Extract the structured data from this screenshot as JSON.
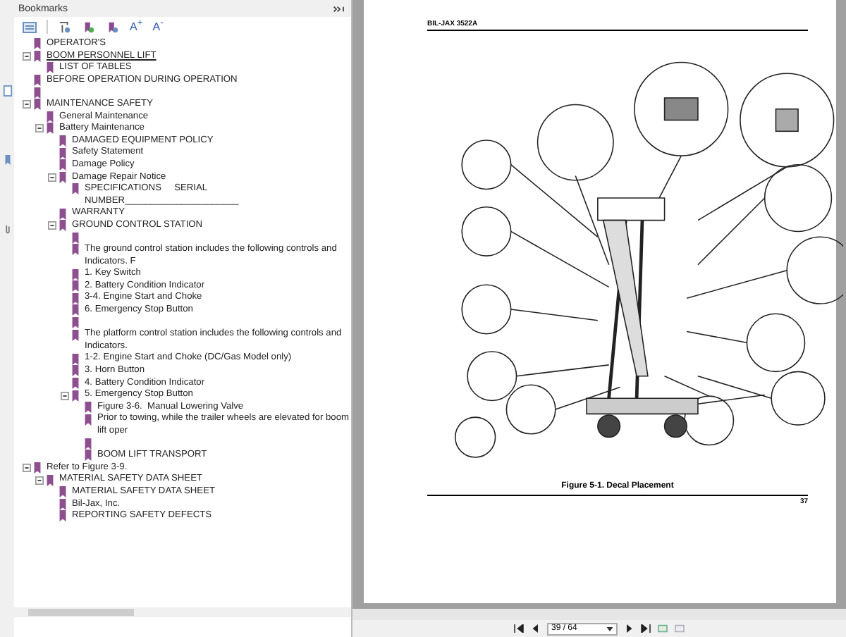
{
  "panel": {
    "title": "Bookmarks"
  },
  "font_buttons": [
    "A$^{+}$",
    "A$^{-}$"
  ],
  "bookmarks": [
    {
      "label": "OPERATOR'S"
    },
    {
      "label": "BOOM PERSONNEL LIFT",
      "expanded": true,
      "children": [
        {
          "label": "LIST OF TABLES"
        }
      ]
    },
    {
      "label": "BEFORE OPERATION DURING OPERATION"
    },
    {
      "kind": "blank"
    },
    {
      "label": "MAINTENANCE SAFETY",
      "expanded": true,
      "children": [
        {
          "label": "General Maintenance"
        },
        {
          "label": "Battery Maintenance",
          "expanded": true,
          "children": [
            {
              "label": "DAMAGED EQUIPMENT POLICY"
            },
            {
              "label": "Safety Statement"
            },
            {
              "label": "Damage Policy"
            },
            {
              "label": "Damage Repair Notice",
              "expanded": true,
              "children": [
                {
                  "label": "SPECIFICATIONS     SERIAL NUMBER______________________"
                }
              ]
            },
            {
              "label": "WARRANTY"
            },
            {
              "label": "GROUND CONTROL STATION",
              "expanded": true,
              "children": [
                {
                  "kind": "blank"
                },
                {
                  "label": "The ground control station includes the following controls and Indicators. F"
                },
                {
                  "label": "1. Key Switch"
                },
                {
                  "label": "2. Battery Condition Indicator"
                },
                {
                  "label": "3-4. Engine Start and Choke"
                },
                {
                  "label": "6. Emergency Stop Button"
                },
                {
                  "kind": "blank"
                },
                {
                  "label": "The platform control station includes the following controls and Indicators."
                },
                {
                  "label": "1-2. Engine Start and Choke (DC/Gas Model only)"
                },
                {
                  "label": "3. Horn Button"
                },
                {
                  "label": "4. Battery Condition Indicator"
                },
                {
                  "label": "5. Emergency Stop Button",
                  "expanded": true,
                  "children": [
                    {
                      "label": "Figure 3-6.  Manual Lowering Valve"
                    },
                    {
                      "label": "Prior to towing, while the trailer wheels are elevated for boom lift oper"
                    },
                    {
                      "kind": "blank"
                    },
                    {
                      "label": "BOOM LIFT TRANSPORT"
                    }
                  ]
                }
              ]
            }
          ]
        }
      ]
    },
    {
      "label": "Refer to Figure 3-9.",
      "expanded": true,
      "children": [
        {
          "label": "MATERIAL SAFETY DATA SHEET",
          "expanded": true,
          "children": [
            {
              "label": "MATERIAL SAFETY DATA SHEET"
            },
            {
              "label": "Bil-Jax, Inc."
            },
            {
              "label": "REPORTING SAFETY DEFECTS"
            }
          ]
        }
      ]
    }
  ],
  "page": {
    "header": "BIL-JAX 3522A",
    "caption": "Figure 5-1.  Decal Placement",
    "number": "37"
  },
  "navigation": {
    "page_field": "39 / 64"
  }
}
